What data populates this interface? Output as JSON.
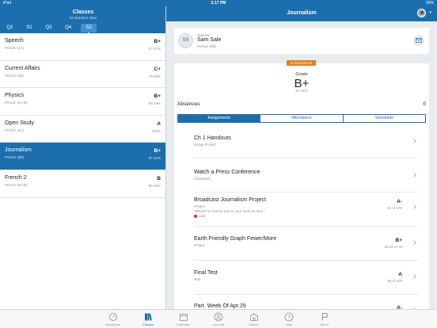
{
  "status_bar": {
    "device": "iPad",
    "time": "2:17 PM",
    "battery": "56%"
  },
  "left": {
    "title": "Classes",
    "subtitle": "for Brandon Allen",
    "terms": [
      "Q2",
      "S1",
      "Q3",
      "Q4",
      "S2"
    ],
    "active_term": "S2",
    "classes": [
      {
        "name": "Speech",
        "period": "Period: 1(A)",
        "grade": "B+",
        "pct": "87.07%"
      },
      {
        "name": "Current Affairs",
        "period": "Period: 1(B)",
        "grade": "C+",
        "pct": "79.83%"
      },
      {
        "name": "Physics",
        "period": "Period: 2(A-B)",
        "grade": "B+",
        "pct": "89.19%"
      },
      {
        "name": "Open Study",
        "period": "Period: 3(A)",
        "grade": "A",
        "pct": "100%"
      },
      {
        "name": "Journalism",
        "period": "Period: 3(B)",
        "grade": "B+",
        "pct": "87.42%"
      },
      {
        "name": "French 2",
        "period": "Period: 4(A-B)",
        "grade": "B",
        "pct": "85.68%"
      }
    ],
    "selected_class": "Journalism"
  },
  "right": {
    "title": "Journalism",
    "teacher": {
      "initials": "SS",
      "label": "Teacher",
      "name": "Sam Sale",
      "period": "Period: 3(B)"
    },
    "status_badge": "IN PROGRESS",
    "grade_label": "Grade",
    "grade": "B+",
    "grade_pct": "87.42%",
    "absences_label": "Absences",
    "absences": "0",
    "segments": [
      "Assignments",
      "Attendance",
      "Standards"
    ],
    "active_segment": "Assignments",
    "assignments": [
      {
        "name": "Ch 1 Handouts",
        "type": "Group Project",
        "note": "",
        "flag": "",
        "grade": "",
        "score": ""
      },
      {
        "name": "Watch a Press Conference",
        "type": "Classwork",
        "note": "",
        "flag": "",
        "grade": "",
        "score": ""
      },
      {
        "name": "Broadcast Journalism Project",
        "type": "Project",
        "note": "\"Please be sure to turn in your work on time.\"",
        "flag": "Late",
        "grade": "A-",
        "score": "91 of 100"
      },
      {
        "name": "Earth Friendly Graph Fewer/More",
        "type": "Project",
        "note": "",
        "flag": "",
        "grade": "B+",
        "score": "65.25 of 75"
      },
      {
        "name": "Final Test",
        "type": "Test",
        "note": "",
        "flag": "",
        "grade": "A",
        "score": "96 of 100"
      },
      {
        "name": "Part. Week Of Apr.29",
        "type": "",
        "note": "",
        "flag": "",
        "grade": "A-",
        "score": ""
      }
    ]
  },
  "tabbar": {
    "tabs": [
      {
        "label": "Dashboard",
        "icon": "dashboard-icon"
      },
      {
        "label": "Classes",
        "icon": "classes-icon"
      },
      {
        "label": "Calendar",
        "icon": "calendar-icon"
      },
      {
        "label": "Account",
        "icon": "account-icon"
      },
      {
        "label": "School",
        "icon": "school-icon"
      },
      {
        "label": "Help",
        "icon": "help-icon"
      },
      {
        "label": "About",
        "icon": "about-icon"
      }
    ],
    "active_tab": "Classes"
  },
  "colors": {
    "primary": "#1c6fae",
    "badge": "#e67e22",
    "late_dot": "#d0312d"
  }
}
